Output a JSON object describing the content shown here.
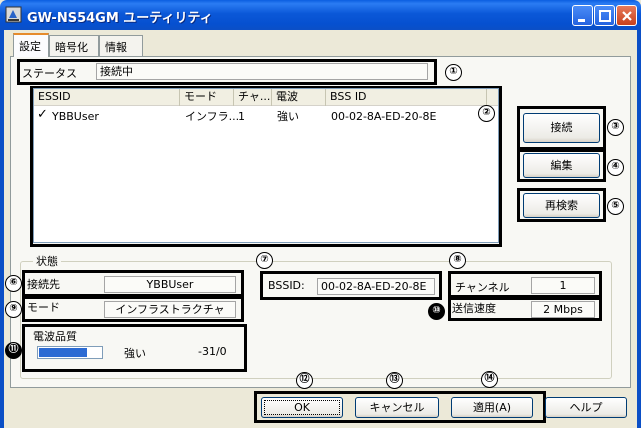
{
  "window": {
    "title": "GW-NS54GM ユーティリティ"
  },
  "tabs": [
    {
      "label": "設定",
      "active": true
    },
    {
      "label": "暗号化",
      "active": false
    },
    {
      "label": "情報",
      "active": false
    }
  ],
  "status": {
    "label": "ステータス",
    "value": "接続中"
  },
  "list": {
    "columns": [
      "ESSID",
      "モード",
      "チャ...",
      "電波",
      "BSS ID"
    ],
    "rows": [
      {
        "check": "✓",
        "essid": "YBBUser",
        "mode": "インフラ...",
        "channel": "1",
        "signal": "強い",
        "bssid": "00-02-8A-ED-20-8E"
      }
    ]
  },
  "side_buttons": {
    "connect": "接続",
    "edit": "編集",
    "rescan": "再検索"
  },
  "state_group": {
    "title": "状態",
    "destination_label": "接続先",
    "destination_value": "YBBUser",
    "mode_label": "モード",
    "mode_value": "インフラストラクチャ",
    "bssid_label": "BSSID:",
    "bssid_value": "00-02-8A-ED-20-8E",
    "channel_label": "チャンネル",
    "channel_value": "1",
    "speed_label": "送信速度",
    "speed_value": "2 Mbps"
  },
  "signal": {
    "label": "電波品質",
    "level_text": "強い",
    "value": "-31/0",
    "level_fraction": 0.78
  },
  "footer": {
    "ok": "OK",
    "cancel": "キャンセル",
    "apply": "適用(A)",
    "help": "ヘルプ"
  },
  "markers": [
    "①",
    "②",
    "③",
    "④",
    "⑤",
    "⑥",
    "⑦",
    "⑧",
    "⑨",
    "⑩",
    "⑪",
    "⑫",
    "⑬",
    "⑭"
  ],
  "colors": {
    "titlebar": "#0b58d8",
    "bar_fill": "#2c6bd3",
    "tab_highlight": "#e68b2c"
  }
}
